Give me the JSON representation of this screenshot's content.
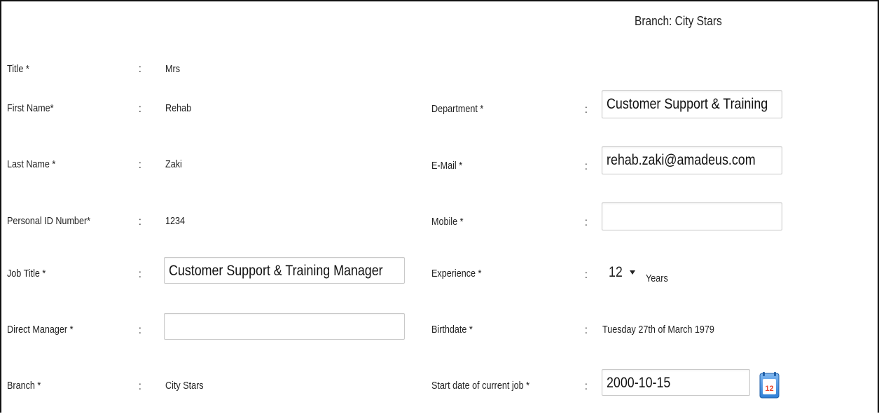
{
  "header": {
    "branch_text": "Branch: City Stars"
  },
  "form": {
    "colon": ":",
    "title": {
      "label": "Title *",
      "value": "Mrs"
    },
    "first_name": {
      "label": "First Name*",
      "value": "Rehab"
    },
    "last_name": {
      "label": "Last Name *",
      "value": "Zaki"
    },
    "personal_id": {
      "label": "Personal ID Number*",
      "value": "1234"
    },
    "job_title": {
      "label": "Job Title *",
      "value": "Customer Support & Training Manager"
    },
    "direct_manager": {
      "label": "Direct Manager *",
      "value": ""
    },
    "branch": {
      "label": "Branch *",
      "value": "City Stars"
    },
    "department": {
      "label": "Department *",
      "value": "Customer Support & Training"
    },
    "email": {
      "label": "E-Mail *",
      "value": "rehab.zaki@amadeus.com"
    },
    "mobile": {
      "label": "Mobile *",
      "value": ""
    },
    "experience": {
      "label": "Experience *",
      "value": "12",
      "unit": "Years"
    },
    "birthdate": {
      "label": "Birthdate *",
      "value": "Tuesday 27th of March 1979"
    },
    "start_date": {
      "label": "Start date of current job *",
      "value": "2000-10-15"
    }
  },
  "icons": {
    "calendar": "calendar-icon",
    "calendar_day": "12",
    "accent": "#2f7fd6",
    "calendar_red": "#e8452c"
  }
}
